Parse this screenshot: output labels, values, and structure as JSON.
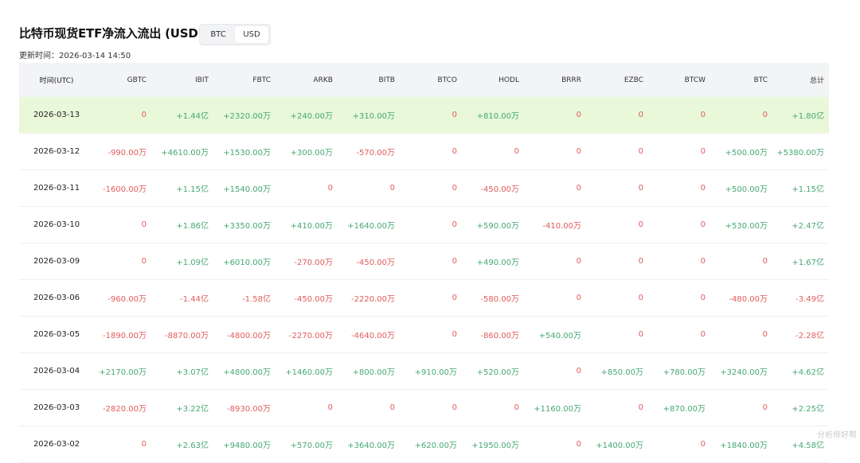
{
  "title": "比特币现货ETF净流入流出 (USD)",
  "toggle": {
    "options": [
      "BTC",
      "USD"
    ],
    "selected": "USD"
  },
  "updated_label": "更新时间：2026-03-14 14:50",
  "table": {
    "columns": [
      "时间(UTC)",
      "GBTC",
      "IBIT",
      "FBTC",
      "ARKB",
      "BITB",
      "BTCO",
      "HODL",
      "BRRR",
      "EZBC",
      "BTCW",
      "BTC",
      "总计"
    ],
    "rows": [
      {
        "cells": [
          "2026-03-13",
          "0",
          "+1.44亿",
          "+2320.00万",
          "+240.00万",
          "+310.00万",
          "0",
          "+810.00万",
          "0",
          "0",
          "0",
          "0",
          "+1.80亿"
        ],
        "highlight": true
      },
      {
        "cells": [
          "2026-03-12",
          "-990.00万",
          "+4610.00万",
          "+1530.00万",
          "+300.00万",
          "-570.00万",
          "0",
          "0",
          "0",
          "0",
          "0",
          "+500.00万",
          "+5380.00万"
        ]
      },
      {
        "cells": [
          "2026-03-11",
          "-1600.00万",
          "+1.15亿",
          "+1540.00万",
          "0",
          "0",
          "0",
          "-450.00万",
          "0",
          "0",
          "0",
          "+500.00万",
          "+1.15亿"
        ]
      },
      {
        "cells": [
          "2026-03-10",
          "0",
          "+1.86亿",
          "+3350.00万",
          "+410.00万",
          "+1640.00万",
          "0",
          "+590.00万",
          "-410.00万",
          "0",
          "0",
          "+530.00万",
          "+2.47亿"
        ]
      },
      {
        "cells": [
          "2026-03-09",
          "0",
          "+1.09亿",
          "+6010.00万",
          "-270.00万",
          "-450.00万",
          "0",
          "+490.00万",
          "0",
          "0",
          "0",
          "0",
          "+1.67亿"
        ]
      },
      {
        "cells": [
          "2026-03-06",
          "-960.00万",
          "-1.44亿",
          "-1.58亿",
          "-450.00万",
          "-2220.00万",
          "0",
          "-580.00万",
          "0",
          "0",
          "0",
          "-480.00万",
          "-3.49亿"
        ]
      },
      {
        "cells": [
          "2026-03-05",
          "-1890.00万",
          "-8870.00万",
          "-4800.00万",
          "-2270.00万",
          "-4640.00万",
          "0",
          "-860.00万",
          "+540.00万",
          "0",
          "0",
          "0",
          "-2.28亿"
        ]
      },
      {
        "cells": [
          "2026-03-04",
          "+2170.00万",
          "+3.07亿",
          "+4800.00万",
          "+1460.00万",
          "+800.00万",
          "+910.00万",
          "+520.00万",
          "0",
          "+850.00万",
          "+780.00万",
          "+3240.00万",
          "+4.62亿"
        ]
      },
      {
        "cells": [
          "2026-03-03",
          "-2820.00万",
          "+3.22亿",
          "-8930.00万",
          "0",
          "0",
          "0",
          "0",
          "+1160.00万",
          "0",
          "+870.00万",
          "0",
          "+2.25亿"
        ]
      },
      {
        "cells": [
          "2026-03-02",
          "0",
          "+2.63亿",
          "+9480.00万",
          "+570.00万",
          "+3640.00万",
          "+620.00万",
          "+1950.00万",
          "0",
          "+1400.00万",
          "0",
          "+1840.00万",
          "+4.58亿"
        ]
      }
    ]
  },
  "watermark": "分析师好帮",
  "colors": {
    "positive": "#45a874",
    "negative": "#e25c5c",
    "highlight_row": "#e8f8d9",
    "header_bg": "#f3f4f6"
  }
}
